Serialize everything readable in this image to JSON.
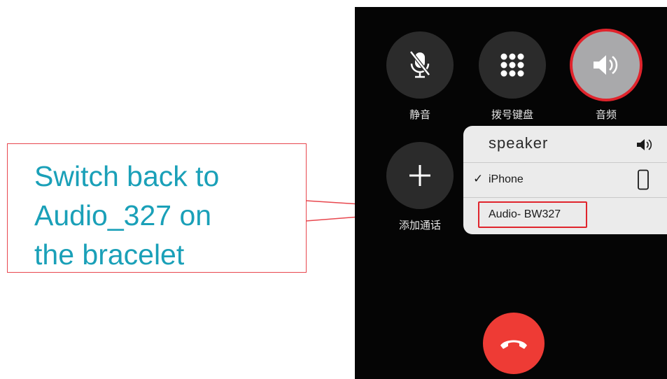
{
  "callout": {
    "text": "Switch back to\nAudio_327 on\nthe bracelet"
  },
  "controls": {
    "mute_label": "静音",
    "keypad_label": "拨号键盘",
    "audio_label": "音频",
    "add_call_label": "添加通话"
  },
  "audio_menu": {
    "options": [
      {
        "label": "speaker",
        "icon": "speaker-icon",
        "selected": false
      },
      {
        "label": "iPhone",
        "icon": "iphone-icon",
        "selected": true
      },
      {
        "label": "Audio- BW327",
        "selected": false,
        "highlighted": true
      }
    ],
    "check_mark": "✓"
  },
  "colors": {
    "callout_border": "#e8474e",
    "callout_text": "#1aa0b8",
    "highlight_red": "#e0242c",
    "end_call": "#ee3b35",
    "screen_bg": "#050505"
  }
}
